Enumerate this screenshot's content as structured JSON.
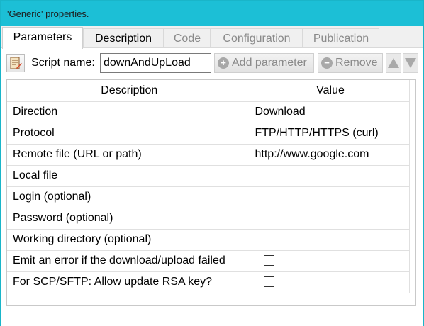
{
  "window": {
    "title": "'Generic' properties."
  },
  "tabs": [
    {
      "label": "Parameters",
      "state": "active"
    },
    {
      "label": "Description",
      "state": "enabled"
    },
    {
      "label": "Code",
      "state": "disabled"
    },
    {
      "label": "Configuration",
      "state": "disabled"
    },
    {
      "label": "Publication",
      "state": "disabled"
    }
  ],
  "toolbar": {
    "icon": "script-edit-icon",
    "script_label": "Script name:",
    "script_value": "downAndUpLoad",
    "add_label": "Add parameter",
    "remove_label": "Remove",
    "add_icon": "plus-circle-icon",
    "remove_icon": "minus-circle-icon",
    "up_icon": "arrow-up-icon",
    "down_icon": "arrow-down-icon"
  },
  "grid": {
    "headers": [
      "Description",
      "Value"
    ],
    "rows": [
      {
        "description": "Direction",
        "value": "Download",
        "type": "text"
      },
      {
        "description": "Protocol",
        "value": "FTP/HTTP/HTTPS (curl)",
        "type": "text"
      },
      {
        "description": "Remote file (URL or path)",
        "value": "http://www.google.com",
        "type": "text"
      },
      {
        "description": "Local file",
        "value": "",
        "type": "text"
      },
      {
        "description": "Login (optional)",
        "value": "",
        "type": "text"
      },
      {
        "description": "Password (optional)",
        "value": "",
        "type": "text"
      },
      {
        "description": "Working directory (optional)",
        "value": "",
        "type": "text"
      },
      {
        "description": "Emit an error if the download/upload failed",
        "checked": false,
        "type": "checkbox"
      },
      {
        "description": "For SCP/SFTP: Allow update RSA key?",
        "checked": false,
        "type": "checkbox"
      }
    ]
  },
  "colors": {
    "titlebar": "#1cbfd6",
    "border": "#19b5c9",
    "disabled_text": "#8a8a8a"
  }
}
